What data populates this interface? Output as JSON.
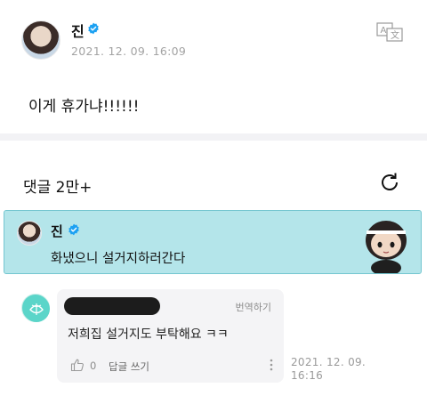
{
  "post": {
    "author": "진",
    "timestamp": "2021. 12. 09. 16:09",
    "body": "이게 휴가냐!!!!!!",
    "verified": true
  },
  "comments": {
    "header": "댓글 2만+",
    "pinned": {
      "author": "진",
      "text": "화냈으니 설거지하러간다"
    },
    "items": [
      {
        "translate_label": "번역하기",
        "text": "저희집 설거지도 부탁해요 ㅋㅋ",
        "like_count": "0",
        "reply_label": "답글 쓰기",
        "time": "2021. 12. 09. 16:16"
      }
    ]
  },
  "colors": {
    "accent": "#1da1f2",
    "pinned_bg": "#b4e5ea",
    "divider": "#f2f2f5"
  }
}
